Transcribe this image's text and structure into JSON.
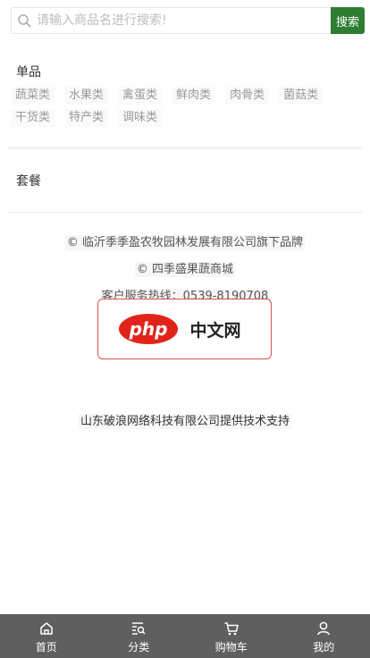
{
  "search": {
    "placeholder": "请输入商品名进行搜索!",
    "button_label": "搜索"
  },
  "singles": {
    "title": "单品",
    "categories": [
      "蔬菜类",
      "水果类",
      "禽蛋类",
      "鲜肉类",
      "肉骨类",
      "菌菇类",
      "干货类",
      "特产类",
      "调味类"
    ]
  },
  "packages": {
    "title": "套餐"
  },
  "footer": {
    "brand_line": "© 临沂季季盈农牧园林发展有限公司旗下品牌",
    "mall_line": "© 四季盛果蔬商城",
    "hotline": "客户服务热线：0539-8190708",
    "logo_text": "php",
    "logo_cn": "中文网",
    "tech_support": "山东破浪网络科技有限公司提供技术支持"
  },
  "tabbar": {
    "items": [
      {
        "label": "首页",
        "icon": "home-icon"
      },
      {
        "label": "分类",
        "icon": "category-search-icon"
      },
      {
        "label": "购物车",
        "icon": "cart-icon"
      },
      {
        "label": "我的",
        "icon": "user-icon"
      }
    ]
  },
  "colors": {
    "search_button": "#2e7d32",
    "tabbar": "#5f5f5f",
    "logo_red": "#d9534f"
  }
}
